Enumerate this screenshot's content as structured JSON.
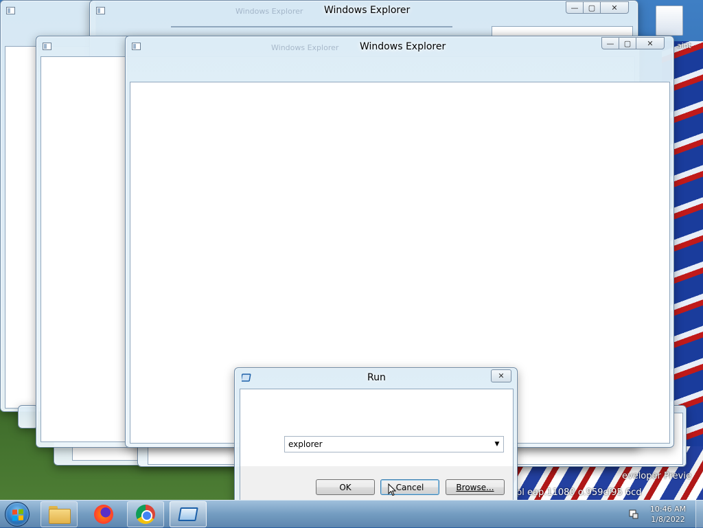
{
  "desktop": {
    "paint_label": "aint",
    "text_line_1": "eveloper Previe",
    "text_line_2": "pl eap.11080        o.959cf95          6cd"
  },
  "windows": {
    "back_explorer": {
      "title": "Windows Explorer",
      "ghost_title": "Windows Explorer"
    },
    "front_explorer": {
      "title": "Windows Explorer",
      "ghost_title": "Windows Explorer"
    }
  },
  "caption_buttons": {
    "minimize": "—",
    "maximize": "▢",
    "close": "✕"
  },
  "run_dialog": {
    "title": "Run",
    "input_value": "explorer",
    "ok_label": "OK",
    "cancel_label": "Cancel",
    "browse_label": "Browse...",
    "close_glyph": "✕"
  },
  "taskbar": {
    "items": [
      {
        "name": "Windows Explorer",
        "icon": "folder-icon"
      },
      {
        "name": "Firefox",
        "icon": "firefox-icon"
      },
      {
        "name": "Google Chrome",
        "icon": "chrome-icon"
      },
      {
        "name": "Run",
        "icon": "run-icon"
      }
    ],
    "clock_time": "10:46 AM",
    "clock_date": "1/8/2022"
  }
}
